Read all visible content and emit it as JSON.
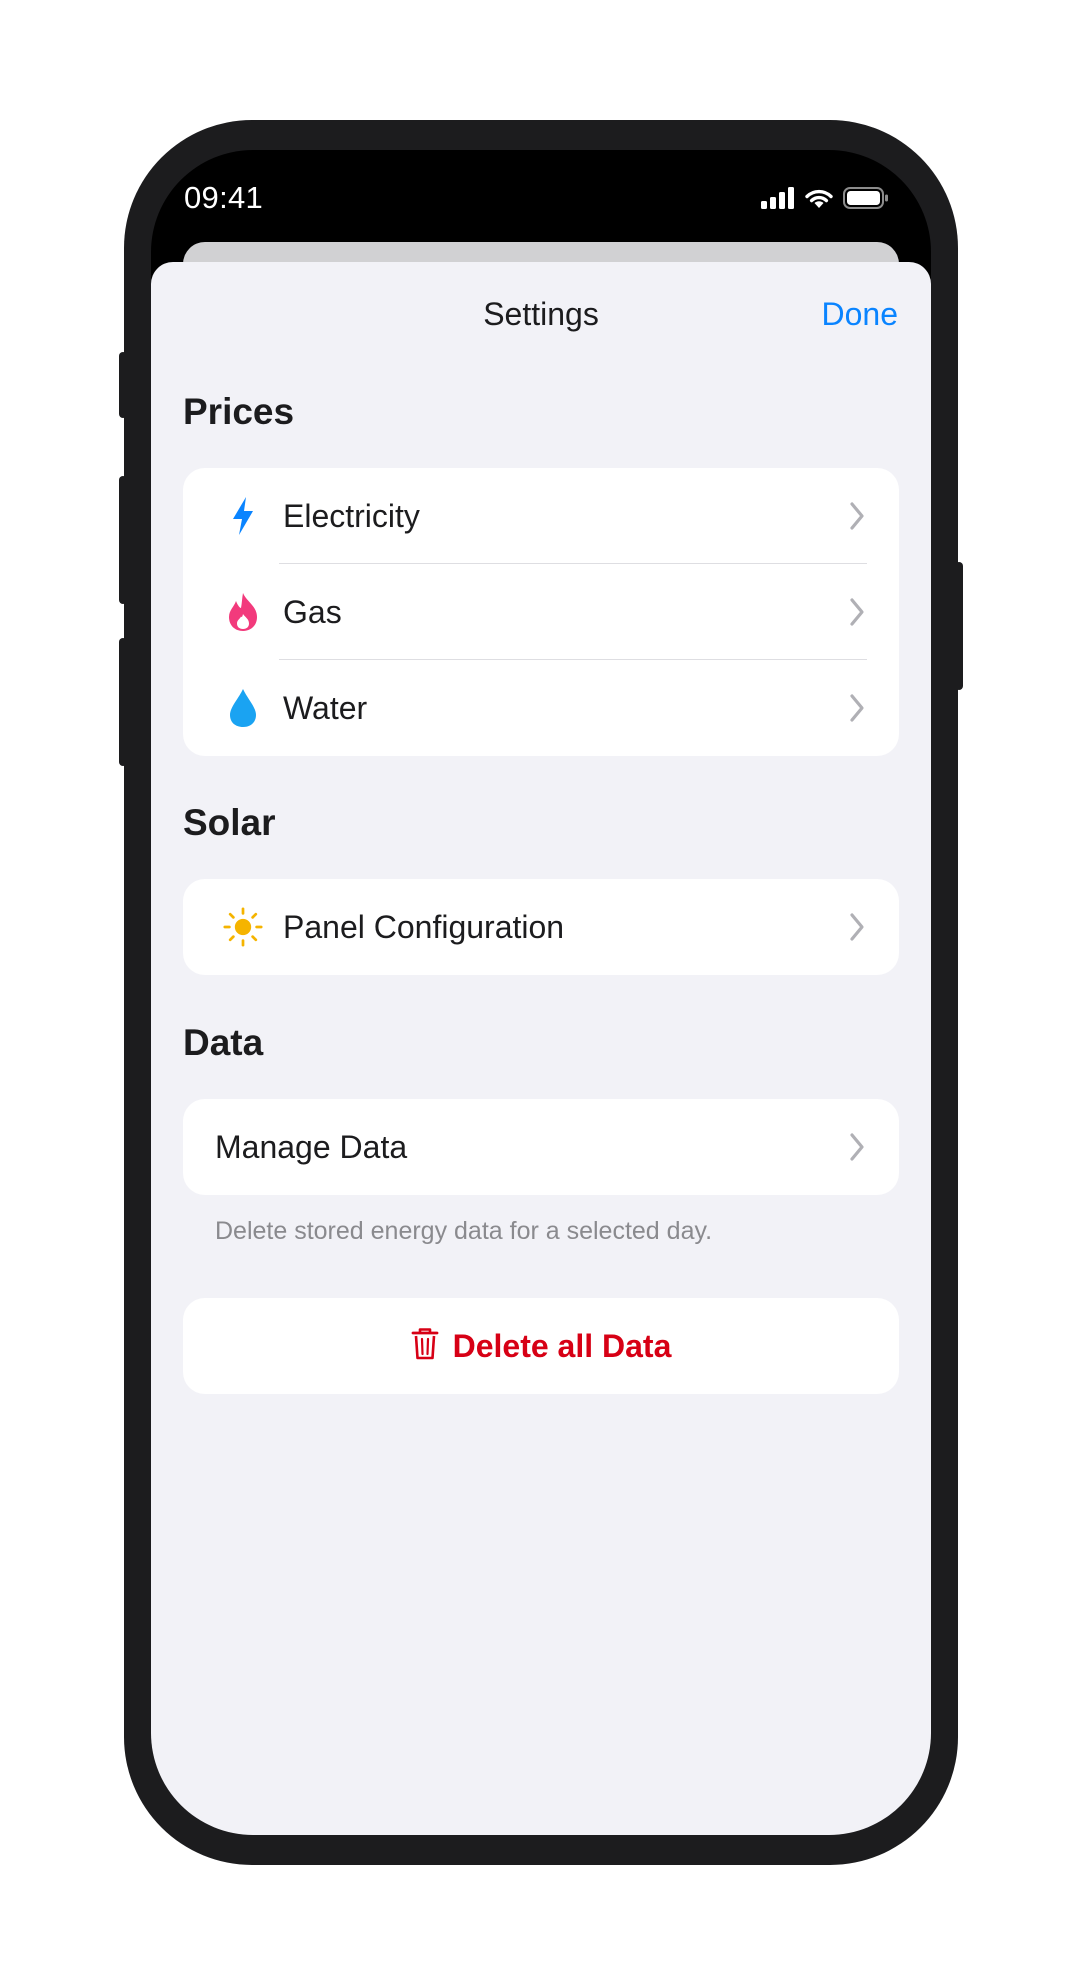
{
  "status_bar": {
    "time": "09:41"
  },
  "nav": {
    "title": "Settings",
    "done_label": "Done"
  },
  "sections": {
    "prices": {
      "header": "Prices",
      "items": [
        {
          "label": "Electricity",
          "icon": "bolt-icon",
          "color": "#0a84ff"
        },
        {
          "label": "Gas",
          "icon": "flame-icon",
          "color": "#f23a7c"
        },
        {
          "label": "Water",
          "icon": "drop-icon",
          "color": "#1aa3f2"
        }
      ]
    },
    "solar": {
      "header": "Solar",
      "items": [
        {
          "label": "Panel Configuration",
          "icon": "sun-icon",
          "color": "#f5b400"
        }
      ]
    },
    "data": {
      "header": "Data",
      "items": [
        {
          "label": "Manage Data"
        }
      ],
      "footer": "Delete stored energy data for a selected day."
    }
  },
  "delete_all": {
    "label": "Delete all Data",
    "icon": "trash-icon",
    "color": "#d70015"
  },
  "colors": {
    "accent": "#0a84ff",
    "background": "#f2f2f7",
    "destructive": "#d70015"
  }
}
